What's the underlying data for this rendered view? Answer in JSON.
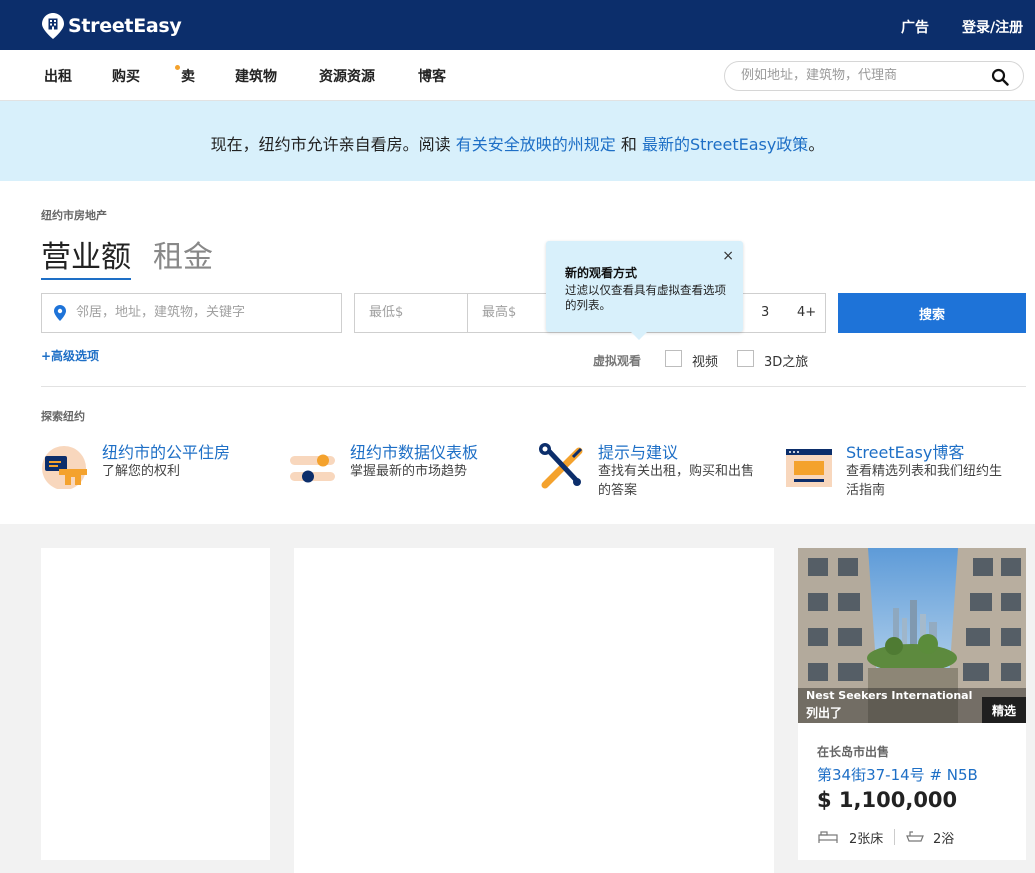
{
  "header": {
    "logo_text": "StreetEasy",
    "ads_label": "广告",
    "login_label": "登录/注册"
  },
  "nav": {
    "items": [
      "出租",
      "购买",
      "卖",
      "建筑物",
      "资源资源",
      "博客"
    ],
    "search_placeholder": "例如地址，建筑物，代理商"
  },
  "banner": {
    "prefix": "现在，纽约市允许亲自看房。阅读 ",
    "link1": "有关安全放映的州规定",
    "middle": " 和 ",
    "link2": "最新的StreetEasy政策",
    "suffix": "。"
  },
  "search": {
    "section_label": "纽约市房地产",
    "tab_sales": "营业额",
    "tab_rentals": "租金",
    "location_placeholder": "邻居，地址，建筑物，关键字",
    "min_placeholder": "最低$",
    "max_placeholder": "最高$",
    "bed_options": [
      "3",
      "4+"
    ],
    "search_button": "搜索",
    "advanced_link": "+高级选项",
    "virtual_label": "虚拟观看",
    "video_label": "视频",
    "tour3d_label": "3D之旅"
  },
  "tooltip": {
    "title": "新的观看方式",
    "body": "过滤以仅查看具有虚拟查看选项的列表。",
    "close": "×"
  },
  "explore": {
    "label": "探索纽约",
    "items": [
      {
        "title": "纽约市的公平住房",
        "desc": "了解您的权利"
      },
      {
        "title": "纽约市数据仪表板",
        "desc": "掌握最新的市场趋势"
      },
      {
        "title": "提示与建议",
        "desc": "查找有关出租，购买和出售的答案"
      },
      {
        "title": "StreetEasy博客",
        "desc": "查看精选列表和我们纽约生活指南"
      }
    ]
  },
  "listing": {
    "broker": "Nest Seekers International",
    "listed_by": "列出了",
    "badge": "精选",
    "area": "在长岛市出售",
    "address": "第34街37-14号 # N5B",
    "price": "$ 1,100,000",
    "beds": "2张床",
    "baths": "2浴"
  },
  "colors": {
    "header_bg": "#0c2e6b",
    "accent": "#1e6fc6",
    "banner_bg": "#d8f0fb",
    "button_bg": "#1e73d8",
    "orange": "#f4a22d"
  }
}
